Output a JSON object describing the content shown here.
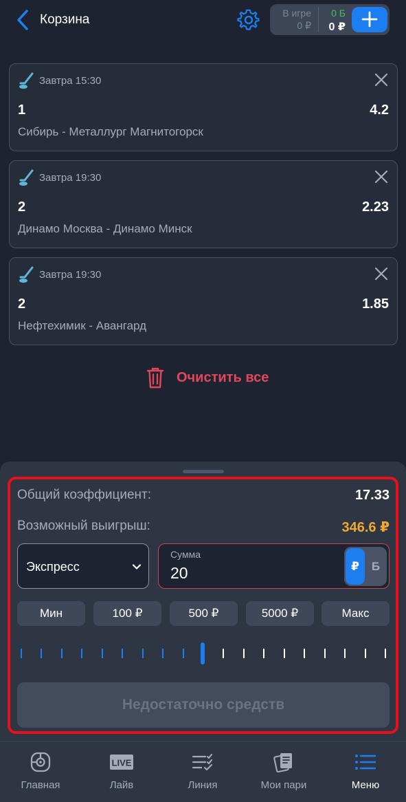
{
  "header": {
    "title": "Корзина",
    "in_game_label": "В игре",
    "in_game_value": "0 ₽",
    "bonus_value": "0 Б",
    "balance_value": "0 ₽"
  },
  "bets": [
    {
      "sport_icon": "hockey-icon",
      "time": "Завтра 15:30",
      "outcome": "1",
      "odds": "4.2",
      "teams": "Сибирь - Металлург Магнитогорск"
    },
    {
      "sport_icon": "hockey-icon",
      "time": "Завтра 19:30",
      "outcome": "2",
      "odds": "2.23",
      "teams": "Динамо Москва - Динамо Минск"
    },
    {
      "sport_icon": "hockey-icon",
      "time": "Завтра 19:30",
      "outcome": "2",
      "odds": "1.85",
      "teams": "Нефтехимик - Авангард"
    }
  ],
  "clear_all_label": "Очистить все",
  "coupon": {
    "total_odds_label": "Общий коэффициент:",
    "total_odds_value": "17.33",
    "possible_win_label": "Возможный выигрыш:",
    "possible_win_value": "346.6 ₽",
    "bet_type": "Экспресс",
    "amount_label": "Сумма",
    "amount_value": "20",
    "currency_rub": "₽",
    "currency_bonus": "Б",
    "quick_amounts": [
      "Мин",
      "100 ₽",
      "500 ₽",
      "5000 ₽",
      "Макс"
    ],
    "slider_level": 0.5,
    "submit_label": "Недостаточно средств"
  },
  "nav": [
    {
      "label": "Главная",
      "icon": "home-icon"
    },
    {
      "label": "Лайв",
      "icon": "live-icon"
    },
    {
      "label": "Линия",
      "icon": "line-list-icon"
    },
    {
      "label": "Мои пари",
      "icon": "my-bets-icon"
    },
    {
      "label": "Меню",
      "icon": "menu-icon",
      "active": true
    }
  ],
  "colors": {
    "background": "#1d2330",
    "accent": "#1d7ef2",
    "danger": "#e5465a",
    "win": "#f0a830",
    "bonus": "#3cc25e",
    "highlight_frame": "#e8101a"
  }
}
